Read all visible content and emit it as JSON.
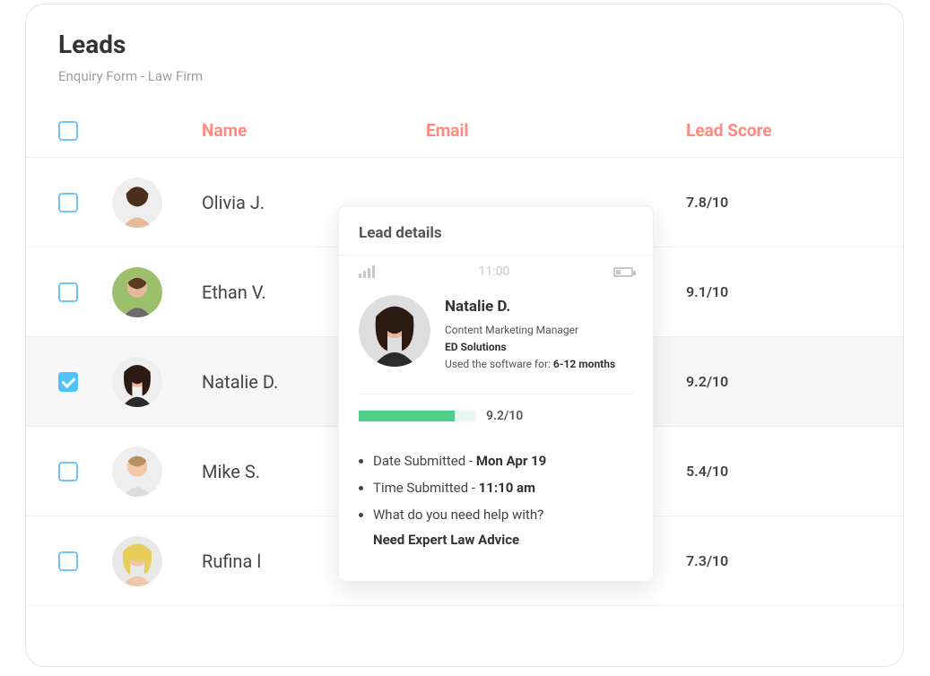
{
  "page": {
    "title": "Leads",
    "subtitle": "Enquiry Form - Law Firm"
  },
  "columns": {
    "name": "Name",
    "email": "Email",
    "score": "Lead Score"
  },
  "leads": [
    {
      "name": "Olivia J.",
      "score": "7.8/10",
      "checked": false
    },
    {
      "name": "Ethan V.",
      "score": "9.1/10",
      "checked": false
    },
    {
      "name": "Natalie D.",
      "score": "9.2/10",
      "checked": true
    },
    {
      "name": "Mike S.",
      "score": "5.4/10",
      "checked": false
    },
    {
      "name": "Rufina l",
      "score": "7.3/10",
      "checked": false
    }
  ],
  "detail": {
    "panel_title": "Lead details",
    "statusbar_time": "11:00",
    "name": "Natalie D.",
    "role": "Content Marketing Manager",
    "company": "ED Solutions",
    "tenure_label": "Used the software for: ",
    "tenure_value": "6-12 months",
    "score": "9.2/10",
    "score_fill_pct": "82%",
    "date_label": "Date Submitted - ",
    "date_value": "Mon Apr 19",
    "time_label": "Time Submitted - ",
    "time_value": "11:10 am",
    "question": "What do you need help with?",
    "answer": "Need Expert Law Advice"
  }
}
